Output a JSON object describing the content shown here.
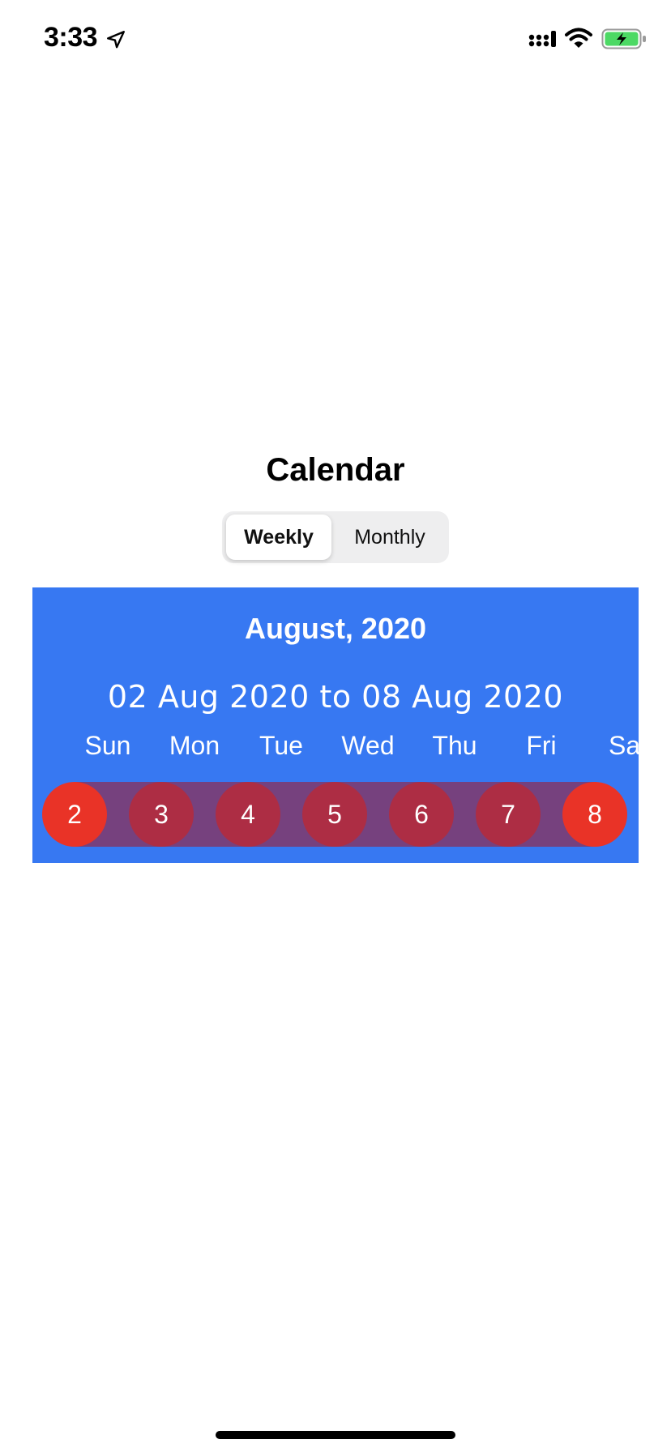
{
  "status_bar": {
    "time": "3:33",
    "icons": [
      "location-arrow-icon",
      "cellular-signal-icon",
      "wifi-icon",
      "battery-charging-icon"
    ],
    "battery_color": "#4cd964"
  },
  "page": {
    "title": "Calendar"
  },
  "segmented_control": {
    "options": [
      "Weekly",
      "Monthly"
    ],
    "selected": "Weekly"
  },
  "calendar": {
    "month_label": "August, 2020",
    "range_label": "02 Aug 2020 to 08 Aug 2020",
    "weekdays": [
      "Sun",
      "Mon",
      "Tue",
      "Wed",
      "Thu",
      "Fri",
      "Sat"
    ],
    "days": [
      "2",
      "3",
      "4",
      "5",
      "6",
      "7",
      "8"
    ],
    "colors": {
      "panel_background": "#3778f2",
      "weekend_circle": "#e93327",
      "weekday_circle": "#ad2d44",
      "row_band": "#76417e"
    }
  }
}
